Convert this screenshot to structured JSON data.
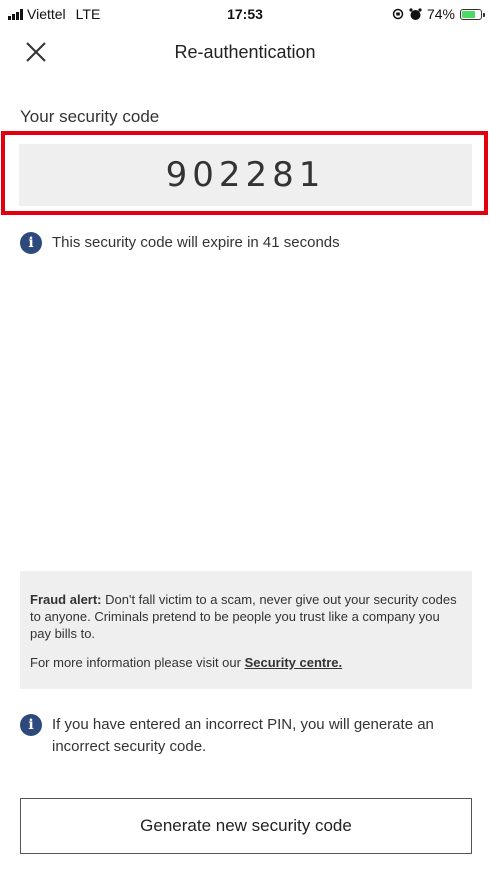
{
  "status_bar": {
    "carrier": "Viettel",
    "network": "LTE",
    "time": "17:53",
    "battery": "74%",
    "battery_level": 0.74
  },
  "header": {
    "title": "Re-authentication",
    "close_icon": "close-icon"
  },
  "security_code": {
    "label": "Your security code",
    "code": "902281",
    "expiry_text": "This security code will expire in 41 seconds"
  },
  "fraud_alert": {
    "title": "Fraud alert:",
    "body": " Don't fall victim to a scam, never give out your security codes to anyone. Criminals pretend to be people you trust like a company you pay bills to.",
    "more_text": "For more information please visit our ",
    "link_text": "Security centre."
  },
  "pin_note": "If you have entered an incorrect PIN, you will generate an incorrect security code.",
  "generate_button": "Generate new security code",
  "colors": {
    "highlight": "#e3000f",
    "info_icon": "#2e4a7d",
    "box_bg": "#efefef"
  }
}
